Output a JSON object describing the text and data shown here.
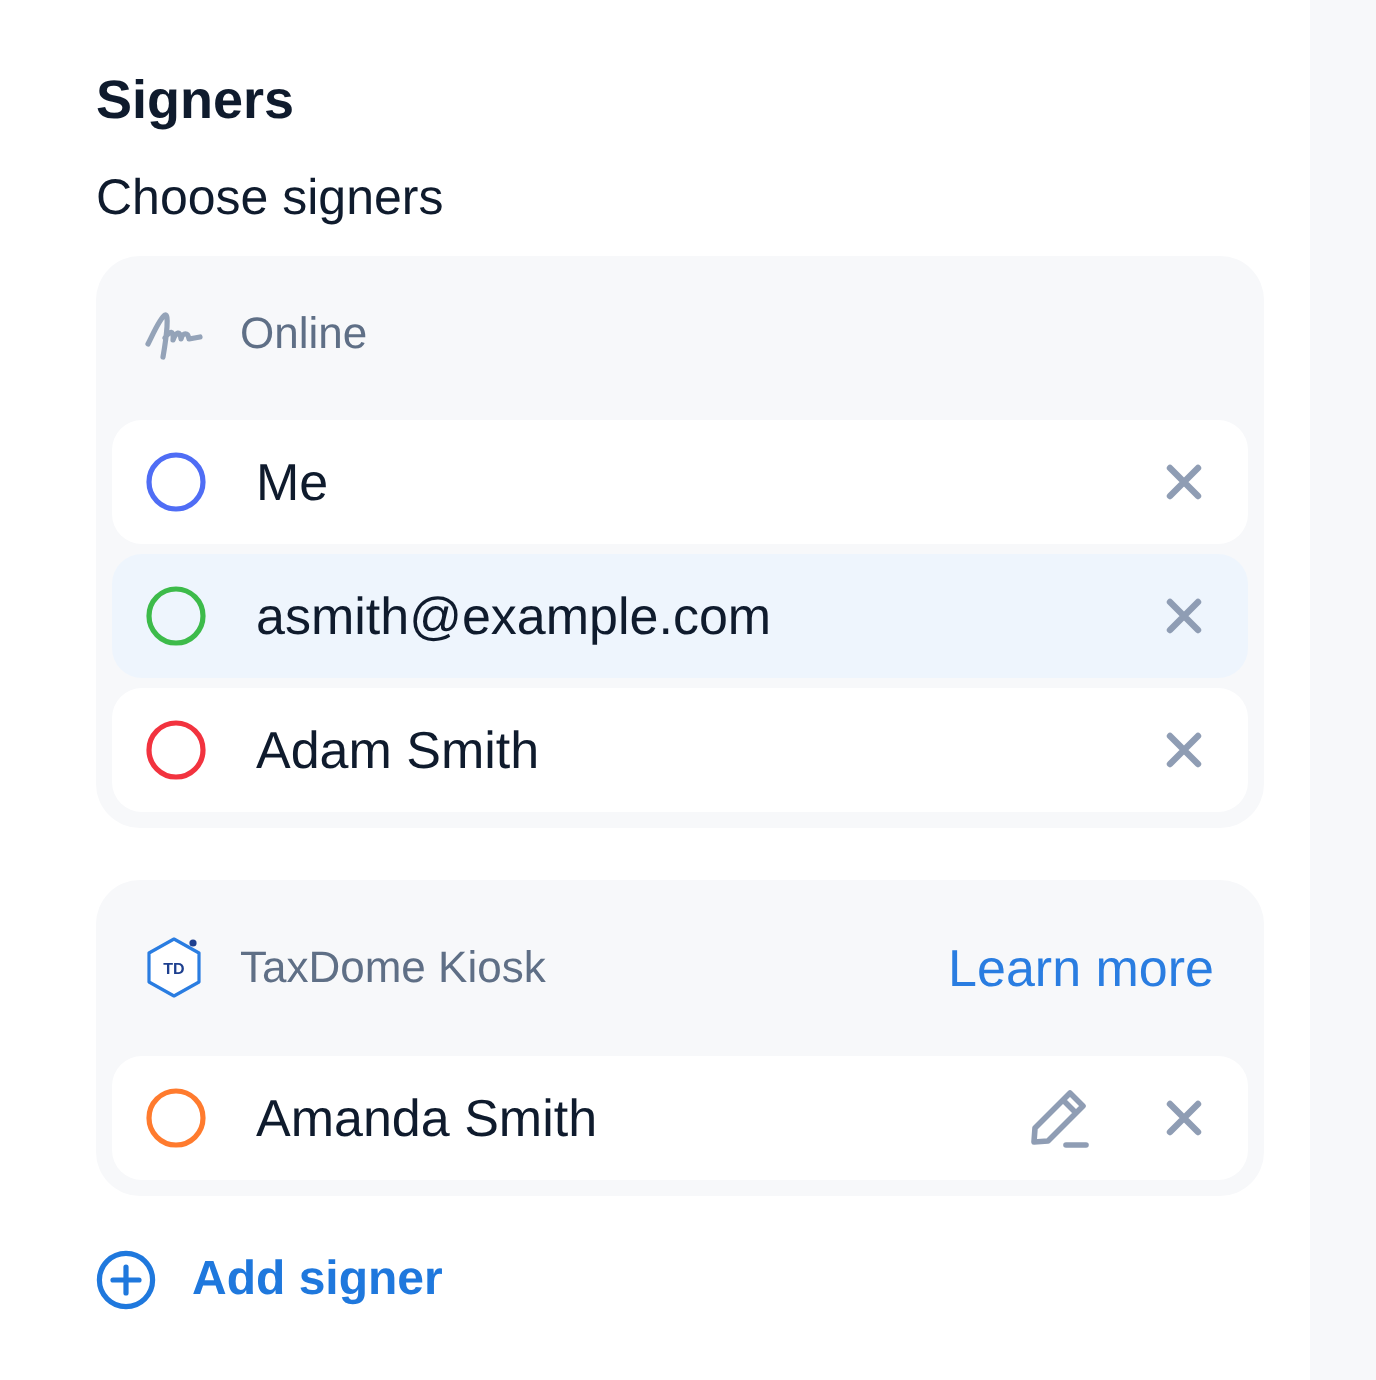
{
  "panel": {
    "title": "Signers",
    "subtitle": "Choose signers"
  },
  "groups": [
    {
      "kind": "online",
      "label": "Online",
      "signers": [
        {
          "name": "Me",
          "color": "#4f6df5",
          "selected": false,
          "editable": false
        },
        {
          "name": "asmith@example.com",
          "color": "#3dbb4a",
          "selected": true,
          "editable": false
        },
        {
          "name": "Adam Smith",
          "color": "#f2333f",
          "selected": false,
          "editable": false
        }
      ]
    },
    {
      "kind": "kiosk",
      "label": "TaxDome Kiosk",
      "logo_text": "TD",
      "link": "Learn more",
      "signers": [
        {
          "name": "Amanda Smith",
          "color": "#ff7b2e",
          "selected": false,
          "editable": true
        }
      ]
    }
  ],
  "add_button": {
    "label": "Add signer"
  }
}
